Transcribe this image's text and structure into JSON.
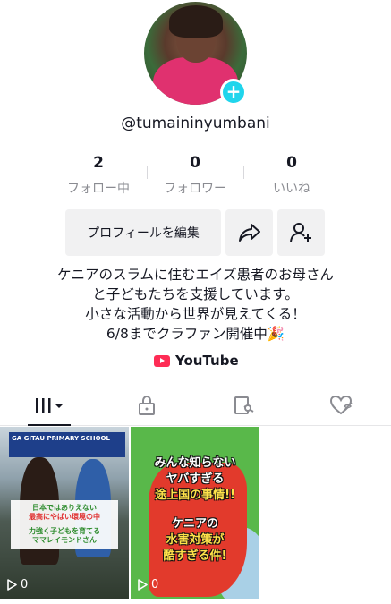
{
  "profile": {
    "username": "@tumaininyumbani",
    "accent_color": "#20d5ec"
  },
  "stats": [
    {
      "value": "2",
      "label": "フォロー中"
    },
    {
      "value": "0",
      "label": "フォロワー"
    },
    {
      "value": "0",
      "label": "いいね"
    }
  ],
  "actions": {
    "edit_profile": "プロフィールを編集"
  },
  "bio": {
    "line1": "ケニアのスラムに住むエイズ患者のお母さん",
    "line2": "と子どもたちを支援しています。",
    "line3": "小さな活動から世界が見えてくる！",
    "line4": "6/8までクラファン開催中🎉"
  },
  "link": {
    "label": "YouTube",
    "color": "#fe2c55"
  },
  "tabs": [
    {
      "icon": "grid-icon",
      "active": true
    },
    {
      "icon": "lock-icon",
      "active": false
    },
    {
      "icon": "tagged-icon",
      "active": false
    },
    {
      "icon": "liked-hidden-icon",
      "active": false
    }
  ],
  "videos": [
    {
      "views": "0",
      "sign": "GA GITAU PRIMARY SCHOOL",
      "caption1": "日本ではありえない",
      "caption2": "最高にやばい環境の中",
      "caption3": "力強く子どもを育てる",
      "caption4": "ママレイモンドさん"
    },
    {
      "views": "0",
      "line1": "みんな知らない",
      "line2": "ヤバすぎる",
      "line3": "途上国の事情!!",
      "line4": "ケニアの",
      "line5": "水害対策が",
      "line6": "酷すぎる件!"
    }
  ]
}
